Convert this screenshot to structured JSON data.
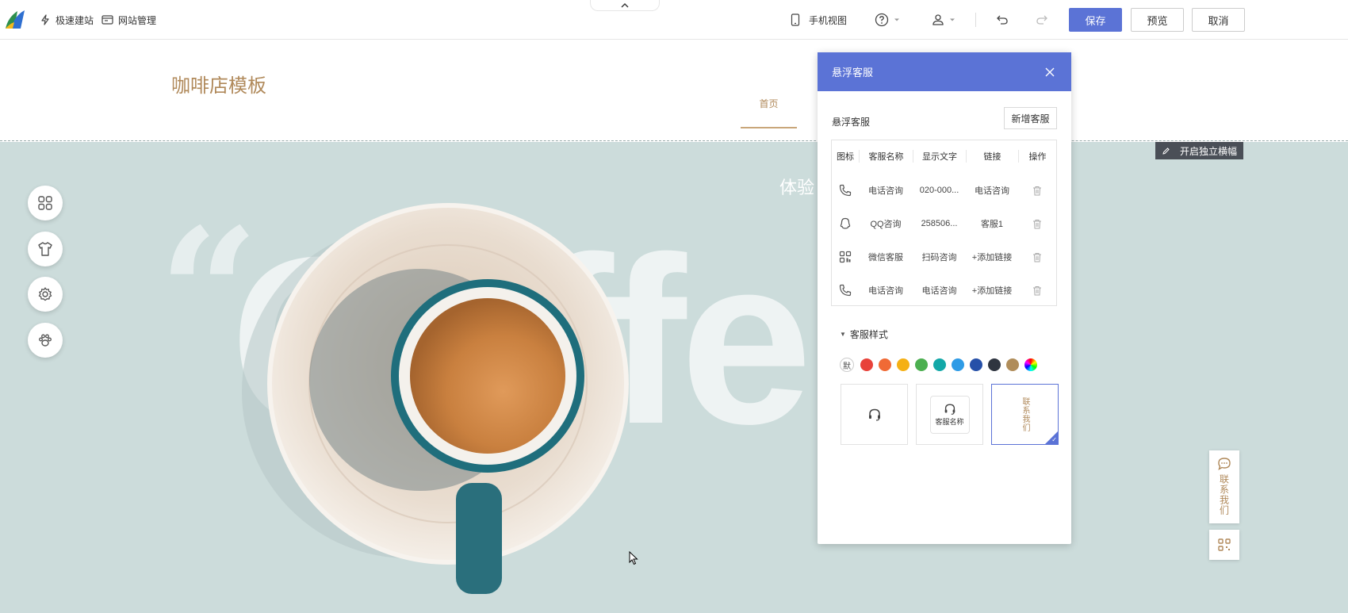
{
  "toolbar": {
    "quick_build": "极速建站",
    "site_manage": "网站管理",
    "mobile_view": "手机视图",
    "save": "保存",
    "preview": "预览",
    "cancel": "取消"
  },
  "site": {
    "title": "咖啡店模板",
    "nav_home": "首页",
    "banner_heading": "体验",
    "bg_word": "Coffe",
    "quote_mark": "“"
  },
  "floating_editor": {
    "block_edit_label": "开启独立横幅",
    "contact_label": "联系我们"
  },
  "panel": {
    "title": "悬浮客服",
    "section_label": "悬浮客服",
    "add_button": "新增客服",
    "table": {
      "headers": [
        "图标",
        "客服名称",
        "显示文字",
        "链接",
        "操作"
      ],
      "rows": [
        {
          "icon": "phone-icon",
          "name": "电话咨询",
          "text": "020-000...",
          "link": "电话咨询"
        },
        {
          "icon": "qq-icon",
          "name": "QQ咨询",
          "text": "258506...",
          "link": "客服1"
        },
        {
          "icon": "qr-code-icon",
          "name": "微信客服",
          "text": "扫码咨询",
          "link": "+添加链接"
        },
        {
          "icon": "phone-icon",
          "name": "电话咨询",
          "text": "电话咨询",
          "link": "+添加链接"
        }
      ]
    },
    "style_section": "客服样式",
    "default_swatch": "默",
    "colors": [
      "#e8423a",
      "#f06a35",
      "#f5b014",
      "#4caf50",
      "#13a8a8",
      "#2e9be6",
      "#2650a8",
      "#2f3540",
      "#b08d5a"
    ],
    "style_card_2_label": "客服名称",
    "style_card_3_label": "联系我们"
  }
}
